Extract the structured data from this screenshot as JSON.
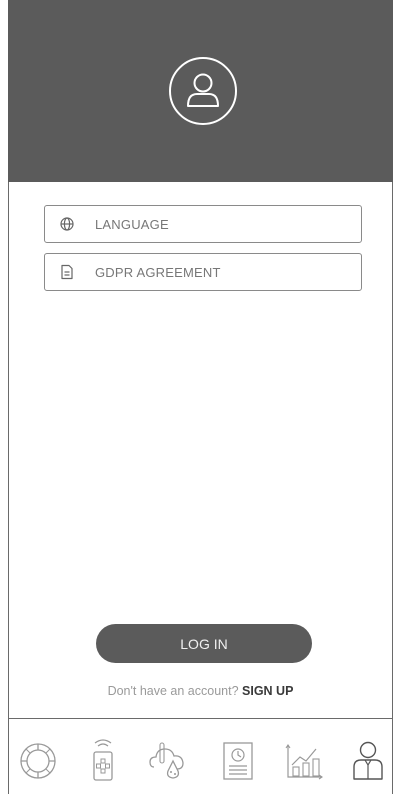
{
  "header": {
    "avatar_icon": "user-circle-icon"
  },
  "menu": {
    "items": [
      {
        "label": "LANGUAGE",
        "icon": "globe-icon"
      },
      {
        "label": "GDPR AGREEMENT",
        "icon": "document-icon"
      }
    ]
  },
  "login": {
    "button_label": "LOG IN"
  },
  "signup": {
    "prompt": "Don't have an account? ",
    "link": "SIGN UP"
  },
  "bottom_nav": {
    "tabs": [
      {
        "icon": "controller-icon"
      },
      {
        "icon": "remote-icon"
      },
      {
        "icon": "weather-icon"
      },
      {
        "icon": "report-icon"
      },
      {
        "icon": "statistics-icon"
      },
      {
        "icon": "profile-icon"
      }
    ]
  },
  "colors": {
    "header": "#5b5b5b",
    "button": "#5b5b5b",
    "border": "#8a8a8a"
  }
}
